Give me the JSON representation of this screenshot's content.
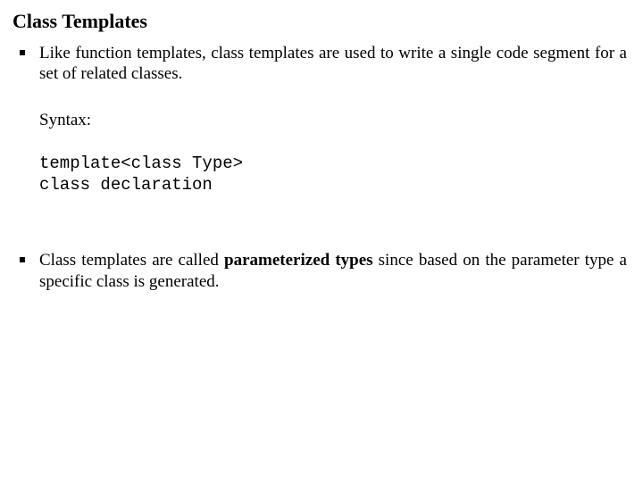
{
  "heading": "Class Templates",
  "bullet1": {
    "text": "Like function templates, class templates are used to write a single code segment for a set of related classes.",
    "syntax_label": "Syntax:",
    "code_line1": "template<class Type>",
    "code_line2": "class declaration"
  },
  "bullet2": {
    "pre": "Class templates are called ",
    "bold": "parameterized types",
    "post": " since based on the parameter type a specific class is generated."
  }
}
